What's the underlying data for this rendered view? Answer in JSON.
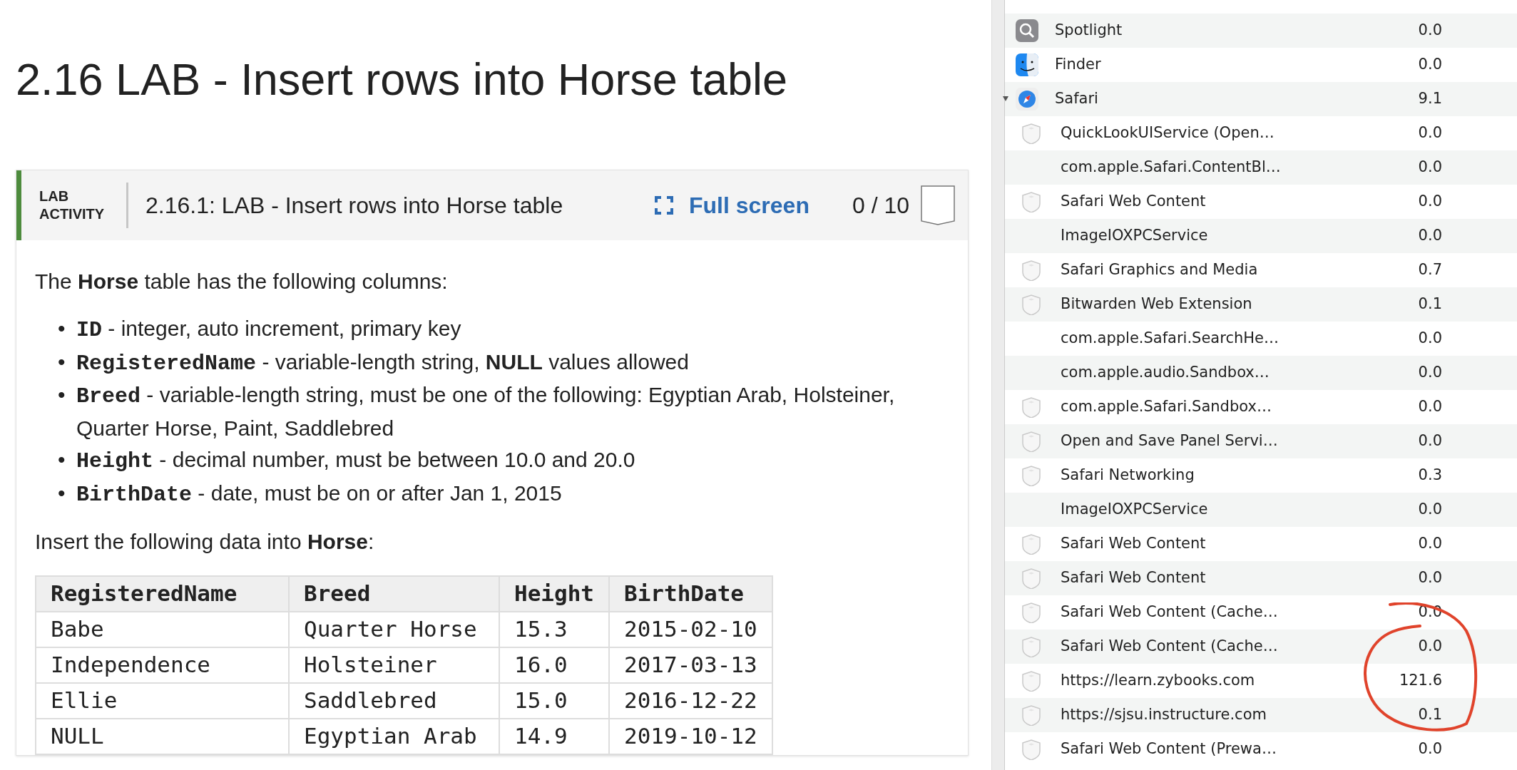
{
  "lesson": {
    "heading": "2.16 LAB - Insert rows into Horse table",
    "activity": {
      "tag": "LAB ACTIVITY",
      "title": "2.16.1: LAB - Insert rows into Horse table",
      "fullscreen": "Full screen",
      "score": "0 / 10"
    },
    "intro": "The **Horse** table has the following columns:",
    "columns": [
      {
        "marker": "•",
        "name": "ID",
        "text": " - integer, auto increment, primary key"
      },
      {
        "marker": "•",
        "name": "RegisteredName",
        "text": " - variable-length string, **NULL** values allowed"
      },
      {
        "marker": "•",
        "name": "Breed",
        "text": " - variable-length string, must be one of the following: Egyptian Arab, Holsteiner, Quarter Horse, Paint, Saddlebred"
      },
      {
        "marker": "•",
        "name": "Height",
        "text": " - decimal number, must be between 10.0 and 20.0"
      },
      {
        "marker": "•",
        "name": "BirthDate",
        "text": " - date, must be on or after Jan 1, 2015"
      }
    ],
    "insert_text": "Insert the following data into **Horse**:",
    "table": {
      "columns": [
        "RegisteredName",
        "Breed",
        "Height",
        "BirthDate"
      ],
      "rows": [
        [
          "Babe",
          "Quarter Horse",
          "15.3",
          "2015-02-10"
        ],
        [
          "Independence",
          "Holsteiner",
          "16.0",
          "2017-03-13"
        ],
        [
          "Ellie",
          "Saddlebred",
          "15.0",
          "2016-12-22"
        ],
        [
          "NULL",
          "Egyptian Arab",
          "14.9",
          "2019-10-12"
        ]
      ]
    }
  },
  "processes": [
    {
      "kind": "spotlight",
      "name": "Spotlight",
      "value": "0.0"
    },
    {
      "kind": "finder",
      "name": "Finder",
      "value": "0.0"
    },
    {
      "kind": "safari",
      "name": "Safari",
      "value": "9.1",
      "expanded": true,
      "children": [
        {
          "kind": "process",
          "name": "QuickLookUIService (Open…",
          "value": "0.0"
        },
        {
          "kind": "none",
          "name": "com.apple.Safari.ContentBl…",
          "value": "0.0"
        },
        {
          "kind": "process",
          "name": "Safari Web Content",
          "value": "0.0"
        },
        {
          "kind": "none",
          "name": "ImageIOXPCService",
          "value": "0.0"
        },
        {
          "kind": "process",
          "name": "Safari Graphics and Media",
          "value": "0.7"
        },
        {
          "kind": "process",
          "name": "Bitwarden Web Extension",
          "value": "0.1"
        },
        {
          "kind": "none",
          "name": "com.apple.Safari.SearchHe…",
          "value": "0.0"
        },
        {
          "kind": "none",
          "name": "com.apple.audio.Sandbox…",
          "value": "0.0"
        },
        {
          "kind": "process",
          "name": "com.apple.Safari.Sandbox…",
          "value": "0.0"
        },
        {
          "kind": "process",
          "name": "Open and Save Panel Servi…",
          "value": "0.0"
        },
        {
          "kind": "process",
          "name": "Safari Networking",
          "value": "0.3"
        },
        {
          "kind": "none",
          "name": "ImageIOXPCService",
          "value": "0.0"
        },
        {
          "kind": "process",
          "name": "Safari Web Content",
          "value": "0.0"
        },
        {
          "kind": "process",
          "name": "Safari Web Content",
          "value": "0.0"
        },
        {
          "kind": "process",
          "name": "Safari Web Content (Cache…",
          "value": "0.0"
        },
        {
          "kind": "process",
          "name": "Safari Web Content (Cache…",
          "value": "0.0"
        },
        {
          "kind": "process",
          "name": "https://learn.zybooks.com",
          "value": "121.6"
        },
        {
          "kind": "process",
          "name": "https://sjsu.instructure.com",
          "value": "0.1"
        },
        {
          "kind": "process",
          "name": "Safari Web Content (Prewa…",
          "value": "0.0"
        }
      ]
    }
  ]
}
